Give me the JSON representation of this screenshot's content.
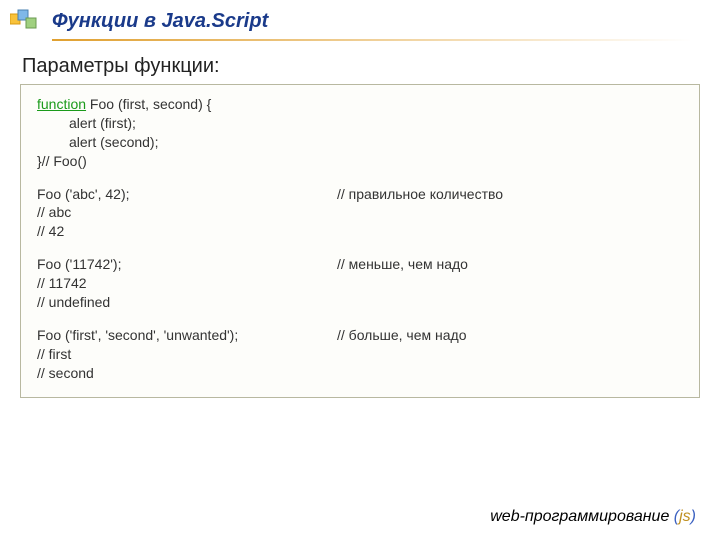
{
  "header": {
    "title": "Функции в Java.Script"
  },
  "subheading": "Параметры функции:",
  "def": {
    "l1a": "function",
    "l1b": " Foo (first, second) {",
    "l2": "alert (first);",
    "l3": "alert (second);",
    "l4": "}// Foo()"
  },
  "ex1": {
    "call": "Foo ('abc', 42);",
    "comment": "// правильное количество",
    "o1": "// abc",
    "o2": "// 42"
  },
  "ex2": {
    "call": "Foo ('11742');",
    "comment": "// меньше, чем надо",
    "o1": "// 11742",
    "o2": "// undefined"
  },
  "ex3": {
    "call": "Foo ('first', 'second', 'unwanted');",
    "comment": "// больше, чем надо",
    "o1": "// first",
    "o2": "// second"
  },
  "footer": {
    "main": "web-программирование ",
    "open": "(",
    "js": "js",
    "close": ")"
  }
}
